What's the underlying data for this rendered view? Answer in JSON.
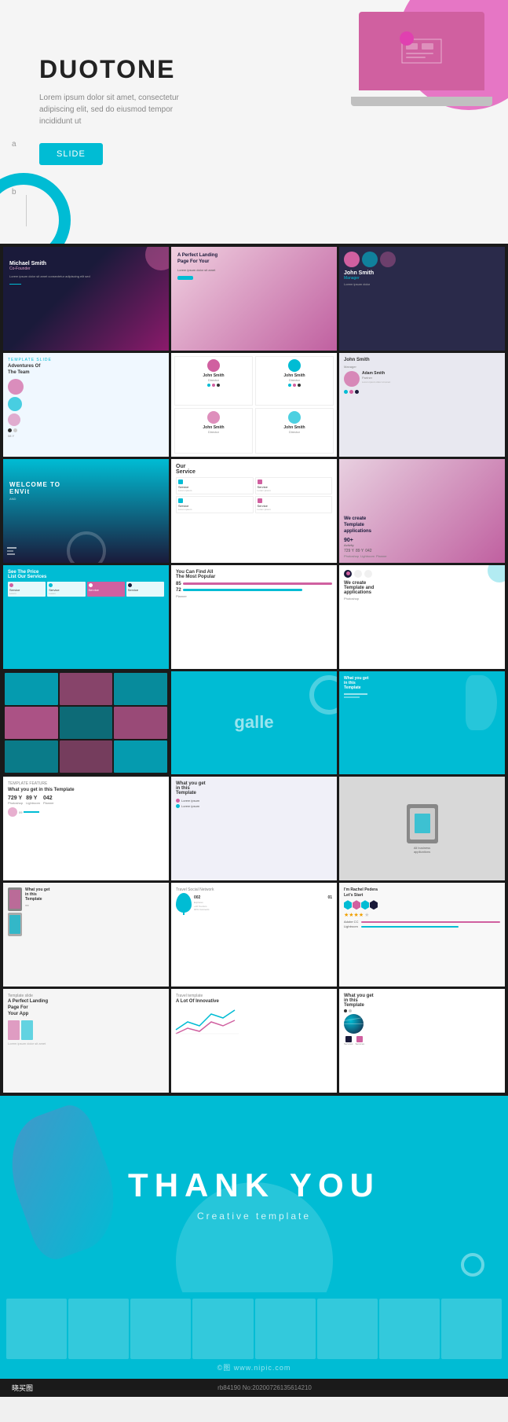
{
  "hero": {
    "title": "DUOTONE",
    "subtitle": "Lorem ipsum dolor sit amet, consectetur adipiscing elit, sed do eiusmod tempor incididunt ut",
    "button_label": "SLIDE",
    "ab_a": "a",
    "ab_b": "b"
  },
  "slides": [
    {
      "id": "s1",
      "type": "pink-dark",
      "title": "Michael Smith",
      "subtitle": "Co-Founder"
    },
    {
      "id": "s2",
      "type": "landing-pink",
      "title": "A Perfect Landing Page For Your"
    },
    {
      "id": "s3",
      "type": "profile-dark",
      "name": "John Smith",
      "role": "Manager"
    },
    {
      "id": "s4",
      "type": "team-blue",
      "title": "Adventures Of The Team"
    },
    {
      "id": "s5",
      "type": "profiles-white",
      "name1": "John Smith",
      "name2": "John Smith"
    },
    {
      "id": "s6",
      "type": "profiles-gray",
      "name": "John Smith"
    },
    {
      "id": "s7",
      "type": "street-blue",
      "title": "WELCOME TO ENVit"
    },
    {
      "id": "s8",
      "type": "service-white",
      "title": "Our Service"
    },
    {
      "id": "s9",
      "type": "woman-pink",
      "title": "We create Template applications"
    },
    {
      "id": "s10",
      "type": "pricing-cyan",
      "title": "See The Price List Our Services"
    },
    {
      "id": "s11",
      "type": "popular-white",
      "title": "You Can Find All The Most Popular"
    },
    {
      "id": "s12",
      "type": "create-white",
      "title": "We create Template and applications"
    },
    {
      "id": "s13",
      "type": "gallery-dark"
    },
    {
      "id": "s14",
      "type": "gallery-cyan",
      "text": "galle"
    },
    {
      "id": "s15",
      "type": "pineapple-cyan",
      "title": "What you get in this Template"
    },
    {
      "id": "s16",
      "type": "what-white",
      "title": "What you get in this Template",
      "stat1": "729 Y",
      "stat2": "89 Y",
      "stat3": "042"
    },
    {
      "id": "s17",
      "type": "what-gray",
      "title": "What you get in this Template"
    },
    {
      "id": "s18",
      "type": "tablet-gray"
    },
    {
      "id": "s19",
      "type": "phone-white",
      "title": "What you get in this Template"
    },
    {
      "id": "s20",
      "type": "social-white",
      "title": "Travel Social Network"
    },
    {
      "id": "s21",
      "type": "rachel-white",
      "name": "I'm Rachel Pedera Let's Start"
    },
    {
      "id": "s22",
      "type": "landing-app",
      "title": "A Perfect Landing Page For Your App"
    },
    {
      "id": "s23",
      "type": "innovative",
      "title": "A Lot Of Innovative"
    },
    {
      "id": "s24",
      "type": "what-template",
      "title": "What you get in this Template"
    }
  ],
  "thank": {
    "title": "THANK    YOU",
    "subtitle": "Creative template"
  },
  "footer": {
    "watermark": "©图 www.nipic.com"
  },
  "bottom": {
    "logo": "晓买图",
    "url": "rb84190 No:20200726135614210",
    "date": ""
  }
}
